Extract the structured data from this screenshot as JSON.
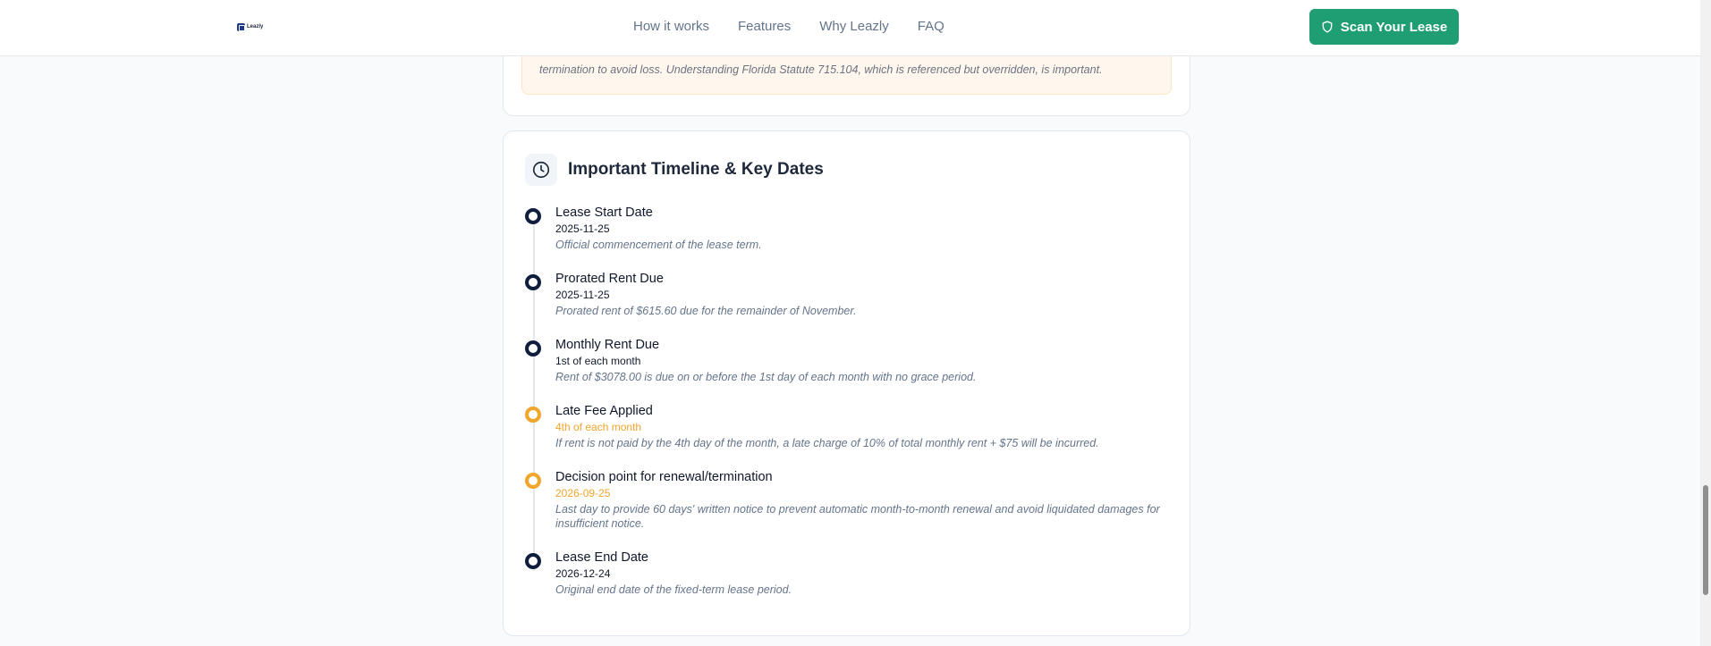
{
  "header": {
    "logo_text": "Leazly",
    "nav": [
      "How it works",
      "Features",
      "Why Leazly",
      "FAQ"
    ],
    "cta_label": "Scan Your Lease"
  },
  "warning": {
    "text": "termination to avoid loss. Understanding Florida Statute 715.104, which is referenced but overridden, is important."
  },
  "timeline": {
    "title": "Important Timeline & Key Dates",
    "items": [
      {
        "title": "Lease Start Date",
        "date": "2025-11-25",
        "desc": "Official commencement of the lease term.",
        "status": "normal"
      },
      {
        "title": "Prorated Rent Due",
        "date": "2025-11-25",
        "desc": "Prorated rent of $615.60 due for the remainder of November.",
        "status": "normal"
      },
      {
        "title": "Monthly Rent Due",
        "date": "1st of each month",
        "desc": "Rent of $3078.00 is due on or before the 1st day of each month with no grace period.",
        "status": "normal"
      },
      {
        "title": "Late Fee Applied",
        "date": "4th of each month",
        "desc": "If rent is not paid by the 4th day of the month, a late charge of 10% of total monthly rent + $75 will be incurred.",
        "status": "warning"
      },
      {
        "title": "Decision point for renewal/termination",
        "date": "2026-09-25",
        "desc": "Last day to provide 60 days' written notice to prevent automatic month-to-month renewal and avoid liquidated damages for insufficient notice.",
        "status": "warning"
      },
      {
        "title": "Lease End Date",
        "date": "2026-12-24",
        "desc": "Original end date of the fixed-term lease period.",
        "status": "normal"
      }
    ]
  },
  "colors": {
    "brand_green": "#1f9d73",
    "dot_normal": "#0f1e3d",
    "dot_warning": "#f0a52b"
  }
}
